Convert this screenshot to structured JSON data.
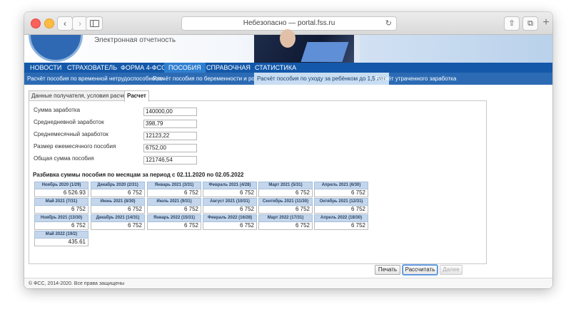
{
  "browser": {
    "address": "Небезопасно — portal.fss.ru"
  },
  "site": {
    "subtitle": "Электронная отчетность"
  },
  "main_nav": [
    {
      "label": "НОВОСТИ",
      "active": false
    },
    {
      "label": "СТРАХОВАТЕЛЬ",
      "active": false
    },
    {
      "label": "ФОРМА 4-ФСС",
      "active": false
    },
    {
      "label": "ПОСОБИЯ",
      "active": true
    },
    {
      "label": "СПРАВОЧНАЯ",
      "active": false
    },
    {
      "label": "СТАТИСТИКА",
      "active": false
    }
  ],
  "sub_nav": [
    {
      "label": "Расчёт пособия по временной нетрудоспособности",
      "active": false
    },
    {
      "label": "Расчёт пособия по беременности и родам",
      "active": false
    },
    {
      "label": "Расчёт пособия по уходу за ребёнком до 1,5 лет",
      "active": true
    },
    {
      "label": "Расчёт утраченного заработка",
      "active": false
    }
  ],
  "tabs": [
    {
      "label": "Данные получателя, условия расчета",
      "active": false
    },
    {
      "label": "Расчет",
      "active": true
    }
  ],
  "fields": [
    {
      "label": "Сумма заработка",
      "value": "140000,00"
    },
    {
      "label": "Среднедневной заработок",
      "value": "398,79"
    },
    {
      "label": "Среднемесячный заработок",
      "value": "12123,22"
    },
    {
      "label": "Размер ежемесячного пособия",
      "value": "6752,00"
    },
    {
      "label": "Общая сумма пособия",
      "value": "121746,54"
    }
  ],
  "breakdown": {
    "title": "Разбивка суммы пособия по месяцам за период с 02.11.2020 по 02.05.2022",
    "months": [
      {
        "label": "Ноябрь 2020 (1/29)",
        "value": "6 526.93"
      },
      {
        "label": "Декабрь 2020 (2/31)",
        "value": "6 752"
      },
      {
        "label": "Январь 2021 (3/31)",
        "value": "6 752"
      },
      {
        "label": "Февраль 2021 (4/28)",
        "value": "6 752"
      },
      {
        "label": "Март 2021 (5/31)",
        "value": "6 752"
      },
      {
        "label": "Апрель 2021 (6/30)",
        "value": "6 752"
      },
      {
        "label": "Май 2021 (7/31)",
        "value": "6 752"
      },
      {
        "label": "Июнь 2021 (8/30)",
        "value": "6 752"
      },
      {
        "label": "Июль 2021 (9/31)",
        "value": "6 752"
      },
      {
        "label": "Август 2021 (10/31)",
        "value": "6 752"
      },
      {
        "label": "Сентябрь 2021 (11/30)",
        "value": "6 752"
      },
      {
        "label": "Октябрь 2021 (12/31)",
        "value": "6 752"
      },
      {
        "label": "Ноябрь 2021 (13/30)",
        "value": "6 752"
      },
      {
        "label": "Декабрь 2021 (14/31)",
        "value": "6 752"
      },
      {
        "label": "Январь 2022 (15/31)",
        "value": "6 752"
      },
      {
        "label": "Февраль 2022 (16/28)",
        "value": "6 752"
      },
      {
        "label": "Март 2022 (17/31)",
        "value": "6 752"
      },
      {
        "label": "Апрель 2022 (18/30)",
        "value": "6 752"
      },
      {
        "label": "Май 2022 (19/2)",
        "value": "435.61"
      }
    ]
  },
  "buttons": {
    "print": "Печать",
    "calculate": "Рассчитать",
    "next": "Далее"
  },
  "footer": "© ФСС, 2014-2020. Все права защищены",
  "colors": {
    "nav_bg": "#1358a9",
    "subnav_bg": "#2c6bb4",
    "active_nav": "#2f7fd0",
    "cell_header": "#c4d6eb"
  }
}
